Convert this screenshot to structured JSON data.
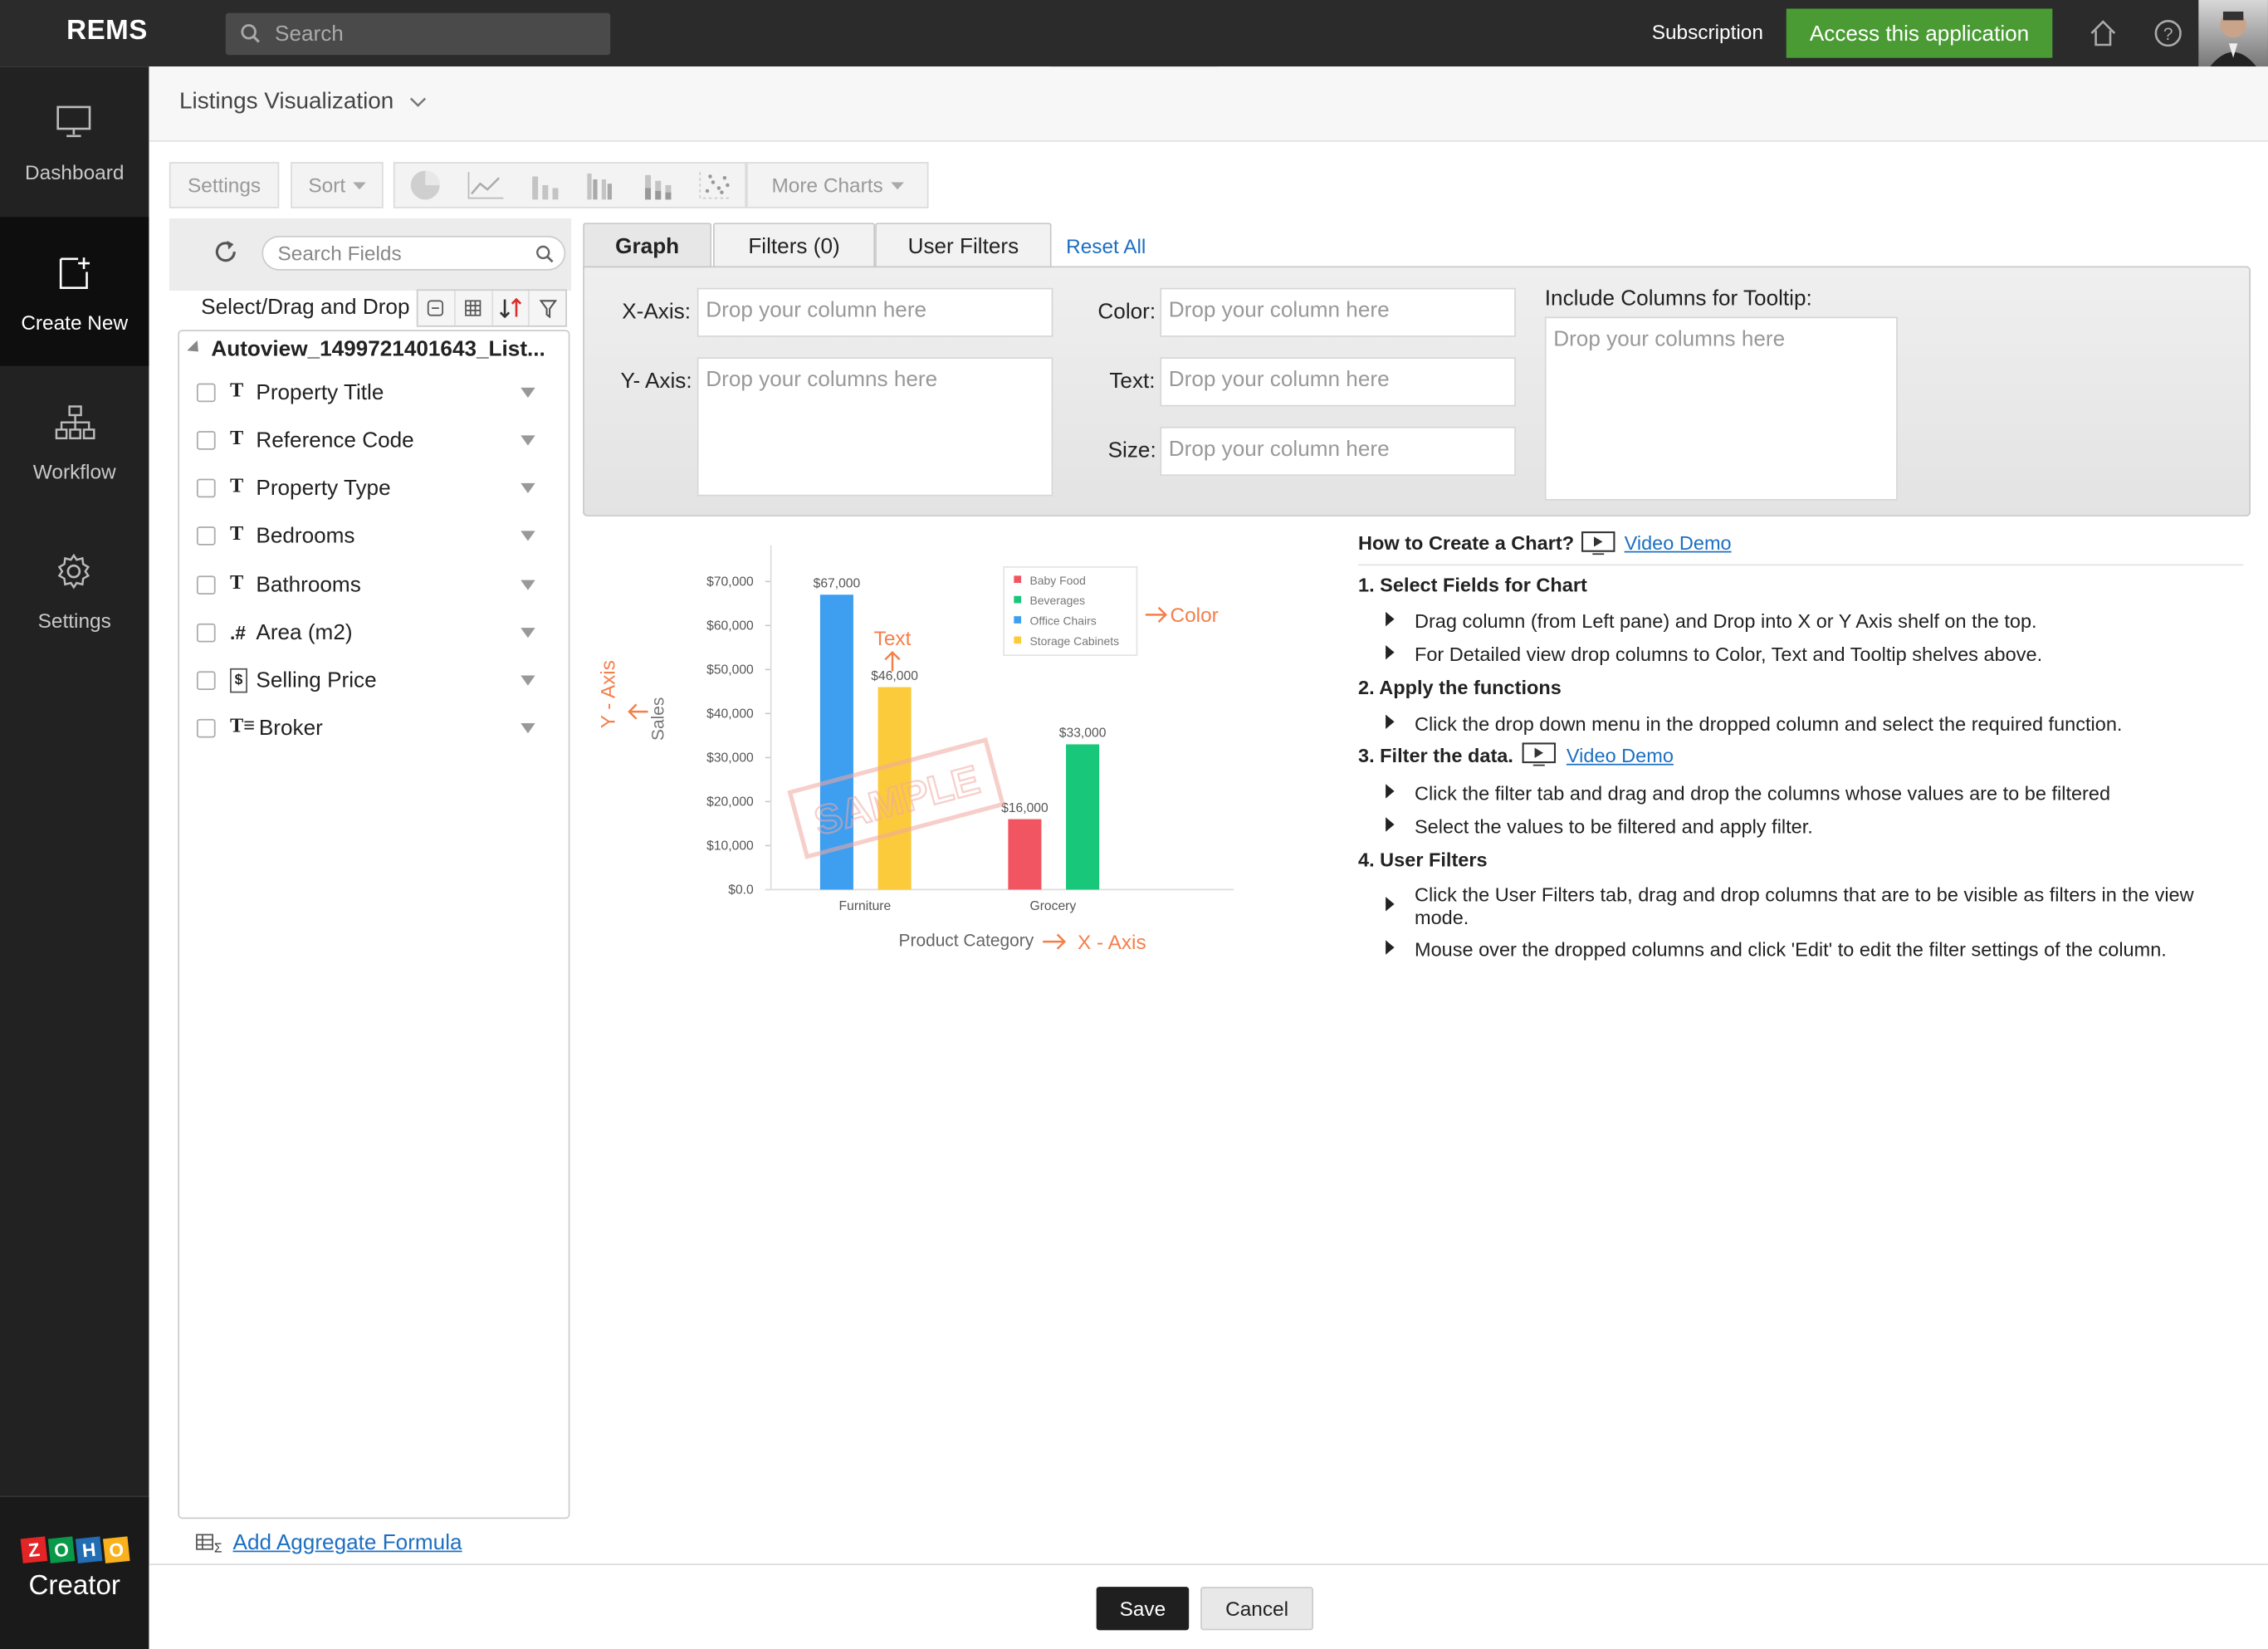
{
  "app": {
    "name": "REMS",
    "search_placeholder": "Search",
    "subscription": "Subscription",
    "access_button": "Access this application"
  },
  "sidebar": {
    "items": [
      {
        "label": "Dashboard",
        "icon": "monitor-icon"
      },
      {
        "label": "Create New",
        "icon": "add-page-icon"
      },
      {
        "label": "Workflow",
        "icon": "hierarchy-icon"
      },
      {
        "label": "Settings",
        "icon": "gear-icon"
      }
    ],
    "footer": {
      "zoho": [
        "Z",
        "O",
        "H",
        "O"
      ],
      "creator": "Creator"
    }
  },
  "page": {
    "title": "Listings Visualization"
  },
  "toolbar": {
    "settings": "Settings",
    "sort": "Sort",
    "more_charts": "More Charts"
  },
  "fields": {
    "search_placeholder": "Search Fields",
    "select_label": "Select/Drag and Drop",
    "view_name": "Autoview_1499721401643_List...",
    "items": [
      {
        "type": "T",
        "name": "Property Title"
      },
      {
        "type": "T",
        "name": "Reference Code"
      },
      {
        "type": "T",
        "name": "Property Type"
      },
      {
        "type": "T",
        "name": "Bedrooms"
      },
      {
        "type": "T",
        "name": "Bathrooms"
      },
      {
        "type": ".#",
        "name": "Area (m2)"
      },
      {
        "type": "$",
        "name": "Selling Price"
      },
      {
        "type": "T≡",
        "name": "Broker"
      }
    ],
    "add_aggregate": "Add Aggregate Formula"
  },
  "tabs": {
    "graph": "Graph",
    "filters": "Filters  (0)",
    "user_filters": "User Filters",
    "reset_all": "Reset All"
  },
  "shelf": {
    "x_label": "X-Axis:",
    "x_placeholder": "Drop your column here",
    "y_label": "Y- Axis:",
    "y_placeholder": "Drop your columns here",
    "color_label": "Color:",
    "color_placeholder": "Drop your column here",
    "text_label": "Text:",
    "text_placeholder": "Drop your column here",
    "size_label": "Size:",
    "size_placeholder": "Drop your column here",
    "tooltip_label": "Include Columns for Tooltip:",
    "tooltip_placeholder": "Drop your columns here"
  },
  "sample": {
    "stamp": "SAMPLE",
    "ann_text": "Text",
    "ann_color": "Color",
    "ann_y": "Y - Axis",
    "ann_x": "X - Axis",
    "ylabel": "Sales",
    "xlabel": "Product Category",
    "yticks": [
      "$70,000",
      "$60,000",
      "$50,000",
      "$40,000",
      "$30,000",
      "$20,000",
      "$10,000",
      "$0.0"
    ],
    "categories": [
      "Furniture",
      "Grocery"
    ],
    "legend": [
      "Baby Food",
      "Beverages",
      "Office Chairs",
      "Storage Cabinets"
    ],
    "colors": {
      "Baby Food": "#f25562",
      "Beverages": "#19c77a",
      "Office Chairs": "#3e9ef0",
      "Storage Cabinets": "#fccb3c"
    }
  },
  "chart_data": {
    "type": "bar",
    "categories": [
      "Furniture",
      "Grocery"
    ],
    "series": [
      {
        "name": "Office Chairs",
        "values": [
          67000,
          null
        ]
      },
      {
        "name": "Storage Cabinets",
        "values": [
          46000,
          null
        ]
      },
      {
        "name": "Baby Food",
        "values": [
          null,
          16000
        ]
      },
      {
        "name": "Beverages",
        "values": [
          null,
          33000
        ]
      }
    ],
    "data_labels": [
      "$67,000",
      "$46,000",
      "$16,000",
      "$33,000"
    ],
    "xlabel": "Product Category",
    "ylabel": "Sales",
    "ylim": [
      0,
      70000
    ],
    "legend": "top-right",
    "grid": false
  },
  "howto": {
    "title": "How to Create a Chart?",
    "video_demo": "Video Demo",
    "s1": "1. Select Fields for Chart",
    "s1a": "Drag column (from Left pane) and Drop into X or Y Axis shelf on the top.",
    "s1b": "For Detailed view drop columns to Color, Text and Tooltip shelves above.",
    "s2": "2. Apply the functions",
    "s2a": "Click the drop down menu in the dropped column and select the required function.",
    "s3": "3. Filter the data.",
    "s3a": "Click the filter tab and drag and drop the columns whose values are to be filtered",
    "s3b": "Select the values to be filtered and apply filter.",
    "s4": "4. User Filters",
    "s4a": "Click the User Filters tab, drag and drop columns that are to be visible as filters in the view mode.",
    "s4b": "Mouse over the dropped columns and click 'Edit' to edit the filter settings of the column."
  },
  "footer": {
    "save": "Save",
    "cancel": "Cancel"
  }
}
